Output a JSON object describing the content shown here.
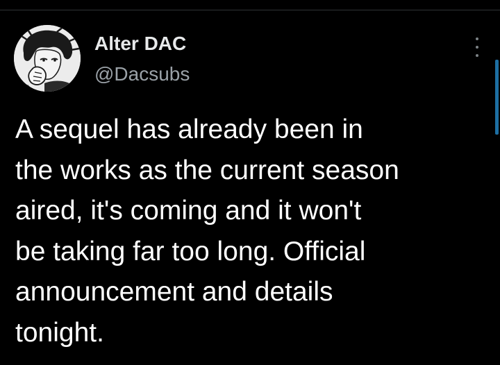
{
  "tweet": {
    "author": {
      "display_name": "Alter DAC",
      "handle": "@Dacsubs",
      "avatar_icon": "manga-portrait-avatar"
    },
    "menu_icon": "more-vertical-icon",
    "text": "A sequel has already been in\nthe works as the current season\naired, it's coming and it won't\nbe taking far too long. Official\nannouncement and details\ntonight."
  },
  "colors": {
    "background": "#000000",
    "text": "#ffffff",
    "secondary_text": "#9aa1a7",
    "divider": "#2f3336",
    "scrollbar": "#1d6fa3"
  }
}
